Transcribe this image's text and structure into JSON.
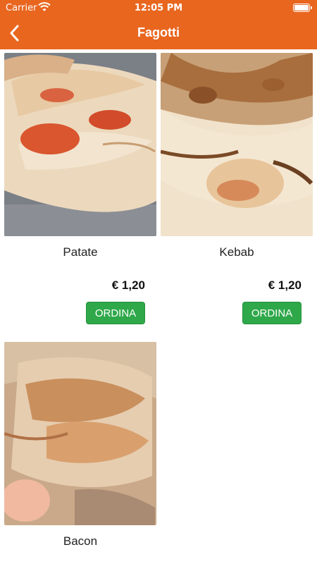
{
  "status_bar": {
    "carrier": "Carrier",
    "time": "12:05 PM",
    "icons": [
      "wifi-icon",
      "battery-icon"
    ]
  },
  "nav": {
    "title": "Fagotti",
    "back_icon": "chevron-left-icon"
  },
  "colors": {
    "header": "#e9661f",
    "order_button": "#2fa84a"
  },
  "products": [
    {
      "name": "Patate",
      "price": "€ 1,20",
      "button_label": "ORDINA"
    },
    {
      "name": "Kebab",
      "price": "€ 1,20",
      "button_label": "ORDINA"
    },
    {
      "name": "Bacon"
    }
  ]
}
